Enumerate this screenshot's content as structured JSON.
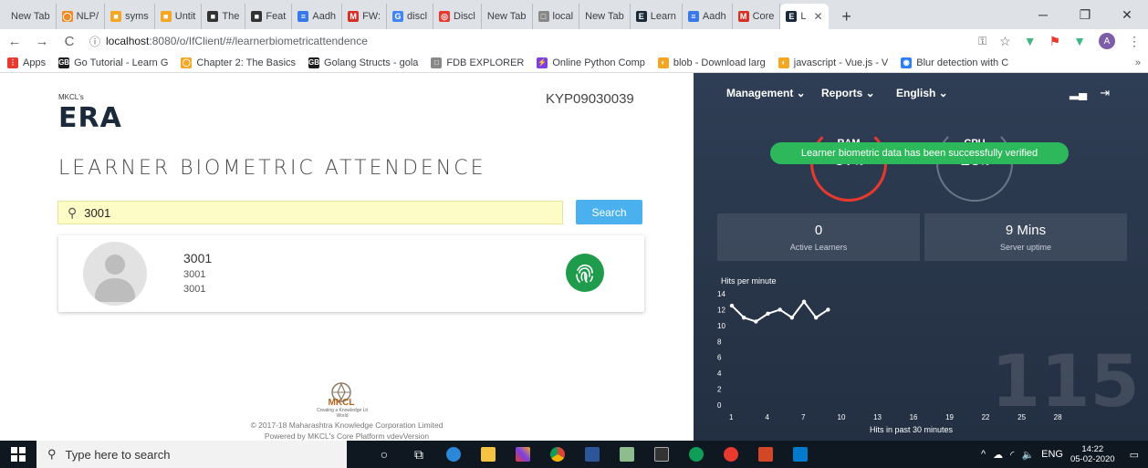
{
  "browser": {
    "tabs": [
      {
        "label": "New Tab",
        "color": "",
        "glyph": ""
      },
      {
        "label": "NLP/",
        "color": "#f08a24",
        "glyph": "◯"
      },
      {
        "label": "syms",
        "color": "#f5a623",
        "glyph": "■"
      },
      {
        "label": "Untit",
        "color": "#f5a623",
        "glyph": "■"
      },
      {
        "label": "The",
        "color": "#333333",
        "glyph": "■"
      },
      {
        "label": "Feat",
        "color": "#333333",
        "glyph": "■"
      },
      {
        "label": "Aadh",
        "color": "#3b78e7",
        "glyph": "≡"
      },
      {
        "label": "FW:",
        "color": "#d93025",
        "glyph": "M"
      },
      {
        "label": "discl",
        "color": "#4285f4",
        "glyph": "G"
      },
      {
        "label": "Discl",
        "color": "#e8392f",
        "glyph": "◎"
      },
      {
        "label": "New Tab",
        "color": "",
        "glyph": ""
      },
      {
        "label": "local",
        "color": "#888888",
        "glyph": "□"
      },
      {
        "label": "New Tab",
        "color": "",
        "glyph": ""
      },
      {
        "label": "Learn",
        "color": "#1a2a3a",
        "glyph": "E"
      },
      {
        "label": "Aadh",
        "color": "#3b78e7",
        "glyph": "≡"
      },
      {
        "label": "Core",
        "color": "#d93025",
        "glyph": "M"
      }
    ],
    "active_tab": {
      "label": "L",
      "glyph": "E"
    },
    "url_host": "localhost",
    "url_path": ":8080/o/IfClient/#/learnerbiometricattendence",
    "bookmarks": [
      {
        "label": "Apps",
        "color": "#e8392f",
        "glyph": "⋮"
      },
      {
        "label": "Go Tutorial - Learn G",
        "color": "#1d1d1d",
        "glyph": "GB"
      },
      {
        "label": "Chapter 2: The Basics",
        "color": "#f5a623",
        "glyph": "◯"
      },
      {
        "label": "Golang Structs - gola",
        "color": "#1d1d1d",
        "glyph": "GB"
      },
      {
        "label": "FDB EXPLORER",
        "color": "#888888",
        "glyph": "□"
      },
      {
        "label": "Online Python Comp",
        "color": "#7b3fe4",
        "glyph": "⚡"
      },
      {
        "label": "blob - Download larg",
        "color": "#f5a623",
        "glyph": "◐"
      },
      {
        "label": "javascript - Vue.js - V",
        "color": "#f5a623",
        "glyph": "◐"
      },
      {
        "label": "Blur detection with C",
        "color": "#2d7ff9",
        "glyph": "◉"
      }
    ],
    "bookmarks_more": "»",
    "window_controls": {
      "minimize": "─",
      "maximize": "❐",
      "close": "✕"
    }
  },
  "left": {
    "logo_small": "MKCL's",
    "logo": "ERA",
    "center_code": "KYP09030039",
    "title": "LEARNER BIOMETRIC ATTENDENCE",
    "search_value": "3001",
    "search_button": "Search",
    "result": {
      "name": "3001",
      "line1": "3001",
      "line2": "3001"
    },
    "footer_logo": "MKCL",
    "footer_logo_tag": "Creating a Knowledge Lit World",
    "footer_line1": "© 2017-18 Maharashtra Knowledge Corporation Limited",
    "footer_line2": "Powered by MKCL's Core Platform vdevVersion"
  },
  "right": {
    "nav": {
      "management": "Management ⌄",
      "reports": "Reports ⌄",
      "language": "English ⌄"
    },
    "toast": "Learner biometric data has been successfully verified",
    "ram": {
      "label": "RAM",
      "value": "87",
      "unit": "%"
    },
    "cpu": {
      "label": "CPU",
      "value": "13",
      "unit": "%"
    },
    "active_learners": {
      "value": "0",
      "label": "Active Learners"
    },
    "server_uptime": {
      "value": "9 Mins",
      "label": "Server uptime"
    },
    "big_number": "115"
  },
  "chart_data": {
    "type": "line",
    "title": "Hits per minute",
    "xlabel": "Hits in past 30 minutes",
    "ylabel": "",
    "x_ticks": [
      1,
      4,
      7,
      10,
      13,
      16,
      19,
      22,
      25,
      28
    ],
    "y_ticks": [
      0,
      2,
      4,
      6,
      8,
      10,
      12,
      14
    ],
    "ylim": [
      0,
      14
    ],
    "xlim": [
      1,
      30
    ],
    "series": [
      {
        "x": [
          1,
          2,
          3,
          4,
          5,
          6,
          7,
          8,
          9
        ],
        "y": [
          12.5,
          11,
          10.5,
          11.5,
          12,
          11,
          13,
          11,
          12
        ]
      }
    ]
  },
  "taskbar": {
    "search_placeholder": "Type here to search",
    "language": "ENG",
    "time": "14:22",
    "date": "05-02-2020"
  }
}
